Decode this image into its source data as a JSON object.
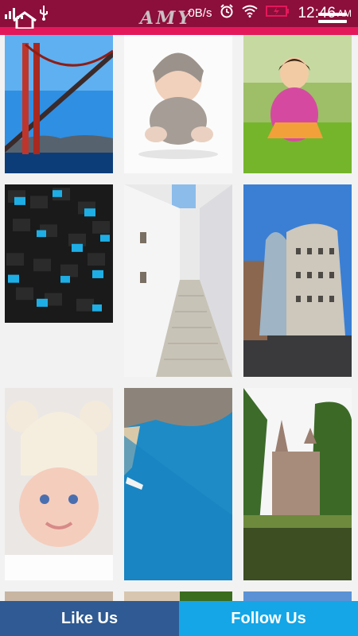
{
  "status_bar": {
    "signal_label": "ill.",
    "data_speed": "0B/s",
    "time": "12:46",
    "ampm": "AM",
    "brand_watermark": "AMY"
  },
  "app": {
    "accent_color": "#e3185a",
    "statusbar_color": "#8c0e3a"
  },
  "gallery": {
    "items": [
      {
        "name": "golden-gate-bridge-wallpaper"
      },
      {
        "name": "baby-sitting-wallpaper"
      },
      {
        "name": "girl-on-grass-wallpaper"
      },
      {
        "name": "blue-cubes-wallpaper"
      },
      {
        "name": "white-street-stairs-wallpaper"
      },
      {
        "name": "dancing-house-wallpaper"
      },
      {
        "name": "baby-knit-hat-wallpaper"
      },
      {
        "name": "blue-bay-wallpaper"
      },
      {
        "name": "castle-lake-wallpaper"
      }
    ]
  },
  "bottom_bar": {
    "like_label": "Like Us",
    "follow_label": "Follow Us",
    "like_color": "#2f5a93",
    "follow_color": "#14a6e6"
  }
}
